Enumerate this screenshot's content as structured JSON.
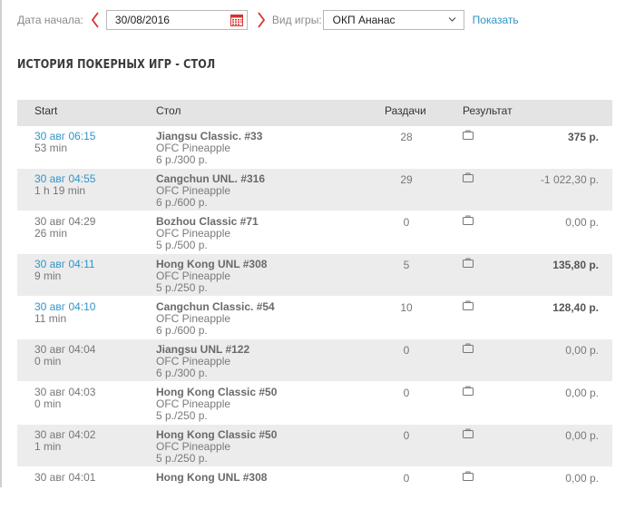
{
  "filters": {
    "date_label": "Дата начала:",
    "date_value": "30/08/2016",
    "game_label": "Вид игры:",
    "game_value": "ОКП Ананас",
    "show_label": "Показать"
  },
  "page_title": "ИСТОРИЯ ПОКЕРНЫХ ИГР - СТОЛ",
  "table": {
    "headers": {
      "start": "Start",
      "table": "Стол",
      "hands": "Раздачи",
      "result": "Результат"
    },
    "rows": [
      {
        "time": "30 авг 06:15",
        "duration": "53 min",
        "name": "Jiangsu Classic. #33",
        "type": "OFC Pineapple",
        "stakes": "6 р./300 р.",
        "hands": "28",
        "amount": "375 р."
      },
      {
        "time": "30 авг 04:55",
        "duration": "1 h 19 min",
        "name": "Cangchun UNL. #316",
        "type": "OFC Pineapple",
        "stakes": "6 р./600 р.",
        "hands": "29",
        "amount": "-1 022,30 р."
      },
      {
        "time": "30 авг 04:29",
        "duration": "26 min",
        "name": "Bozhou Classic #71",
        "type": "OFC Pineapple",
        "stakes": "5 р./500 р.",
        "hands": "0",
        "amount": "0,00 р."
      },
      {
        "time": "30 авг 04:11",
        "duration": "9 min",
        "name": "Hong Kong UNL #308",
        "type": "OFC Pineapple",
        "stakes": "5 р./250 р.",
        "hands": "5",
        "amount": "135,80 р."
      },
      {
        "time": "30 авг 04:10",
        "duration": "11 min",
        "name": "Cangchun Classic. #54",
        "type": "OFC Pineapple",
        "stakes": "6 р./600 р.",
        "hands": "10",
        "amount": "128,40 р."
      },
      {
        "time": "30 авг 04:04",
        "duration": "0 min",
        "name": "Jiangsu UNL #122",
        "type": "OFC Pineapple",
        "stakes": "6 р./300 р.",
        "hands": "0",
        "amount": "0,00 р."
      },
      {
        "time": "30 авг 04:03",
        "duration": "0 min",
        "name": "Hong Kong Classic #50",
        "type": "OFC Pineapple",
        "stakes": "5 р./250 р.",
        "hands": "0",
        "amount": "0,00 р."
      },
      {
        "time": "30 авг 04:02",
        "duration": "1 min",
        "name": "Hong Kong Classic #50",
        "type": "OFC Pineapple",
        "stakes": "5 р./250 р.",
        "hands": "0",
        "amount": "0,00 р."
      },
      {
        "time": "30 авг 04:01",
        "duration": "",
        "name": "Hong Kong UNL #308",
        "type": "",
        "stakes": "",
        "hands": "0",
        "amount": "0,00 р."
      }
    ]
  },
  "icons": {
    "calendar": "calendar-icon",
    "chevron_left": "chevron-left-icon",
    "chevron_right": "chevron-right-icon",
    "dropdown": "dropdown-arrow-icon",
    "result": "briefcase-icon"
  },
  "colors": {
    "accent_red": "#d9312f",
    "link_blue": "#2f95c8",
    "header_bg": "#e4e4e4",
    "stripe_bg": "#ececec"
  }
}
